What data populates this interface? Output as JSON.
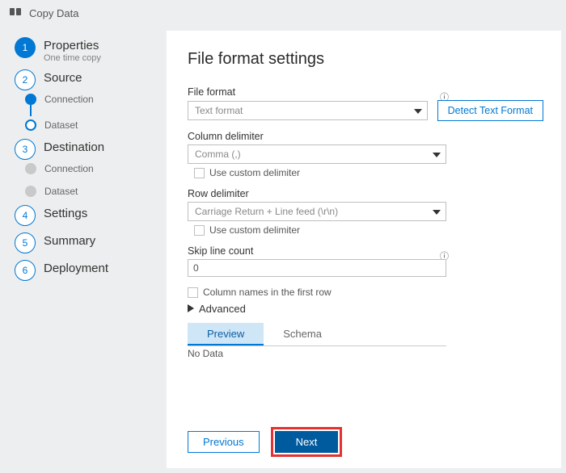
{
  "header": {
    "title": "Copy Data"
  },
  "sidebar": {
    "steps": [
      {
        "title": "Properties",
        "sub": "One time copy"
      },
      {
        "title": "Source",
        "sub_items": [
          "Connection",
          "Dataset"
        ]
      },
      {
        "title": "Destination",
        "sub_items": [
          "Connection",
          "Dataset"
        ]
      },
      {
        "title": "Settings"
      },
      {
        "title": "Summary"
      },
      {
        "title": "Deployment"
      }
    ]
  },
  "page": {
    "title": "File format settings",
    "file_format": {
      "label": "File format",
      "value": "Text format"
    },
    "detect_button": "Detect Text Format",
    "col_delim": {
      "label": "Column delimiter",
      "value": "Comma (,)",
      "custom": "Use custom delimiter"
    },
    "row_delim": {
      "label": "Row delimiter",
      "value": "Carriage Return + Line feed (\\r\\n)",
      "custom": "Use custom delimiter"
    },
    "skip": {
      "label": "Skip line count",
      "value": "0"
    },
    "colnames_first_row": "Column names in the first row",
    "advanced": "Advanced",
    "tabs": {
      "preview": "Preview",
      "schema": "Schema"
    },
    "nodata": "No Data",
    "buttons": {
      "previous": "Previous",
      "next": "Next"
    }
  }
}
